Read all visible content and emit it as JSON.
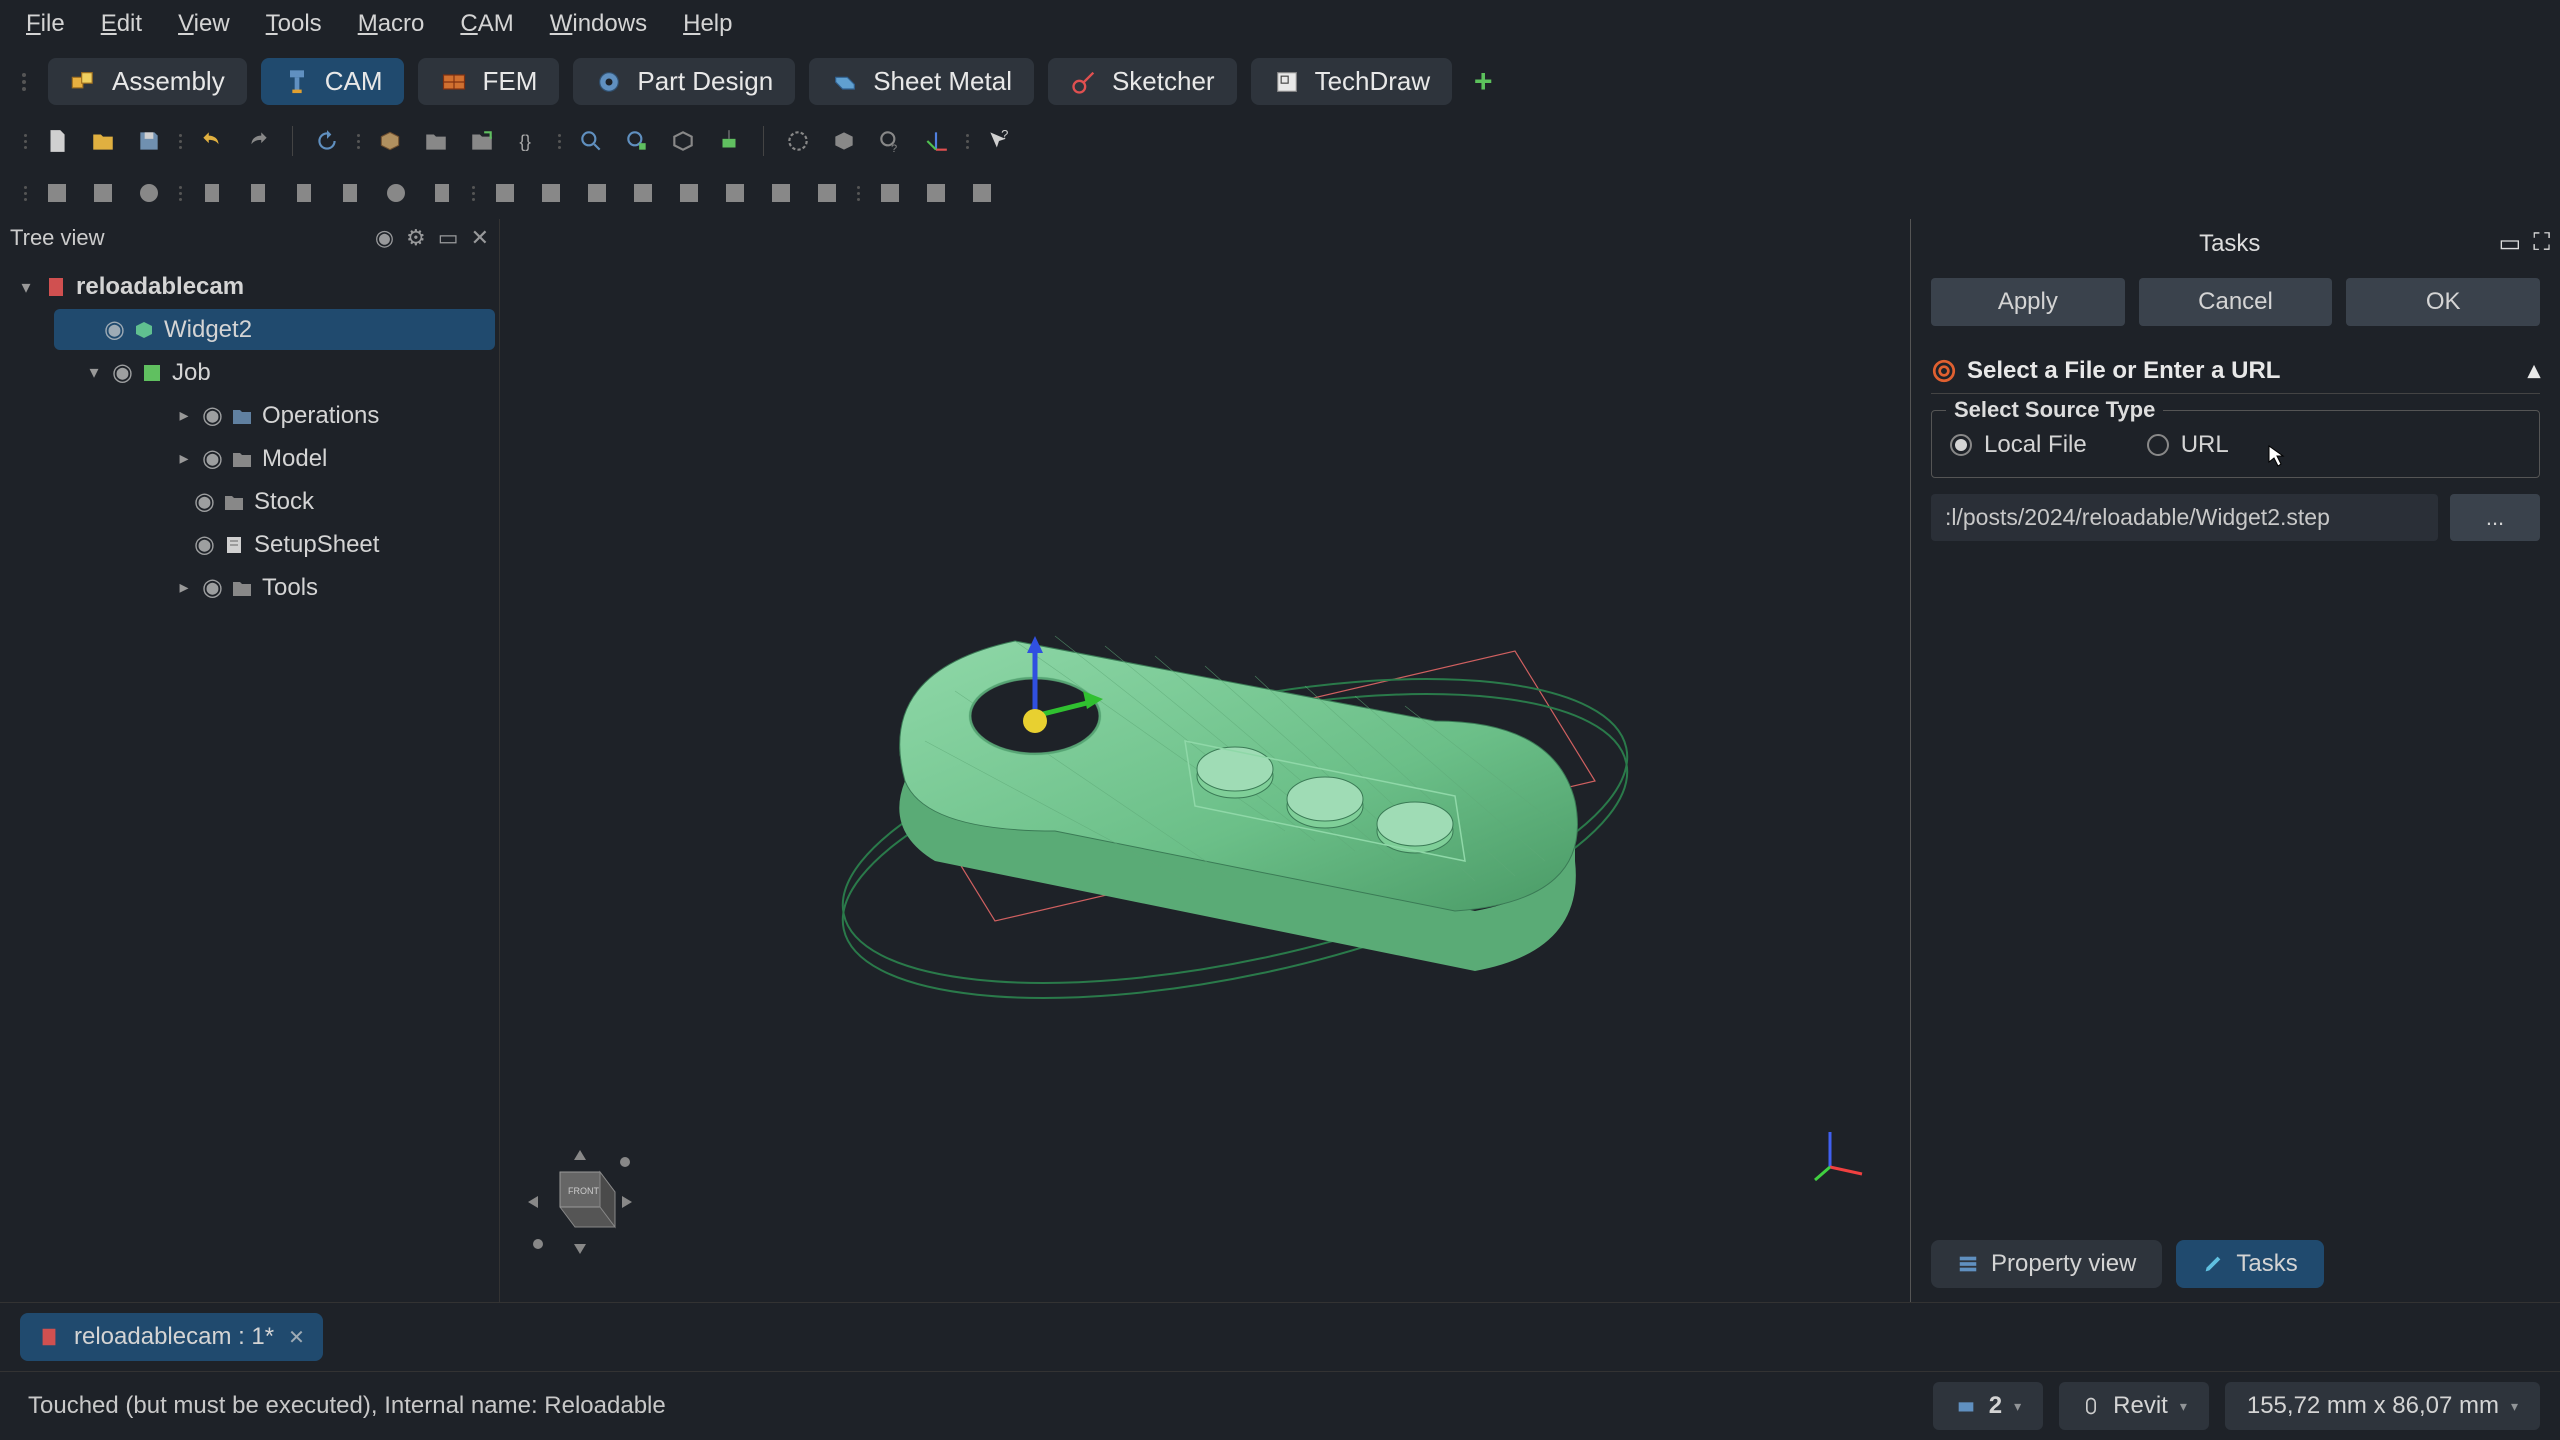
{
  "menubar": [
    "File",
    "Edit",
    "View",
    "Tools",
    "Macro",
    "CAM",
    "Windows",
    "Help"
  ],
  "workbenches": [
    {
      "label": "Assembly",
      "active": false,
      "icon": "assembly"
    },
    {
      "label": "CAM",
      "active": true,
      "icon": "cam"
    },
    {
      "label": "FEM",
      "active": false,
      "icon": "fem"
    },
    {
      "label": "Part Design",
      "active": false,
      "icon": "partdesign"
    },
    {
      "label": "Sheet Metal",
      "active": false,
      "icon": "sheetmetal"
    },
    {
      "label": "Sketcher",
      "active": false,
      "icon": "sketcher"
    },
    {
      "label": "TechDraw",
      "active": false,
      "icon": "techdraw"
    }
  ],
  "tree_panel": {
    "title": "Tree view",
    "items": [
      {
        "label": "reloadablecam",
        "indent": 0,
        "icon": "doc",
        "expanded": true,
        "selected": false,
        "bold": true
      },
      {
        "label": "Widget2",
        "indent": 1,
        "icon": "shape",
        "selected": true,
        "eye": true
      },
      {
        "label": "Job",
        "indent": 1,
        "icon": "job",
        "expanded": true,
        "eye": true
      },
      {
        "label": "Operations",
        "indent": 2,
        "icon": "folder",
        "expandable": true,
        "eye": true
      },
      {
        "label": "Model",
        "indent": 2,
        "icon": "folder",
        "expandable": true,
        "eye": true
      },
      {
        "label": "Stock",
        "indent": 2,
        "icon": "folder",
        "eye": true
      },
      {
        "label": "SetupSheet",
        "indent": 2,
        "icon": "sheet",
        "eye": true
      },
      {
        "label": "Tools",
        "indent": 2,
        "icon": "folder",
        "expandable": true,
        "eye": true
      }
    ]
  },
  "tasks_panel": {
    "title": "Tasks",
    "buttons": {
      "apply": "Apply",
      "cancel": "Cancel",
      "ok": "OK"
    },
    "section_title": "Select a File or Enter a URL",
    "source_type": {
      "legend": "Select Source Type",
      "options": [
        {
          "label": "Local File",
          "checked": true
        },
        {
          "label": "URL",
          "checked": false
        }
      ]
    },
    "file_path": ":l/posts/2024/reloadable/Widget2.step",
    "browse": "...",
    "tabs": [
      {
        "label": "Property view",
        "active": false
      },
      {
        "label": "Tasks",
        "active": true
      }
    ]
  },
  "doc_tab": "reloadablecam : 1*",
  "status_message": "Touched (but must be executed), Internal name: Reloadable",
  "status_right": {
    "layer": "2",
    "nav": "Revit",
    "dims": "155,72 mm x 86,07 mm"
  }
}
